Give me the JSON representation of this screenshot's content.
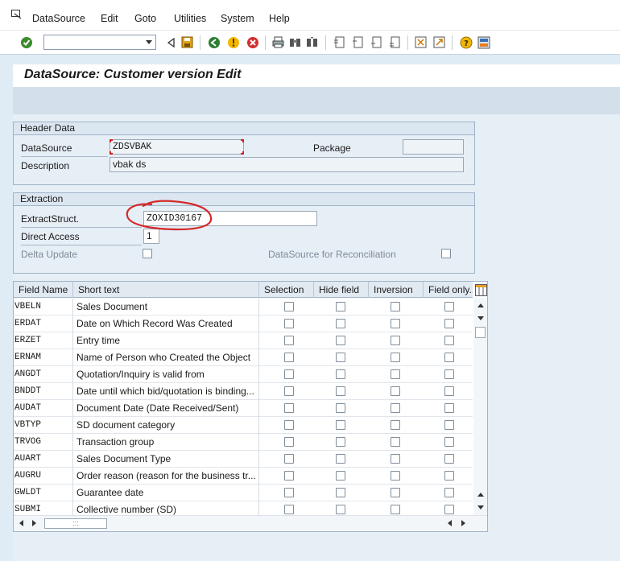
{
  "menu": [
    "DataSource",
    "Edit",
    "Goto",
    "Utilities",
    "System",
    "Help"
  ],
  "title": "DataSource: Customer version Edit",
  "header_group": {
    "title": "Header Data",
    "datasource_label": "DataSource",
    "datasource_value": "ZDSVBAK",
    "package_label": "Package",
    "package_value": "",
    "description_label": "Description",
    "description_value": "vbak ds"
  },
  "extraction_group": {
    "title": "Extraction",
    "extractstruct_label": "ExtractStruct.",
    "extractstruct_value": "ZOXID30167",
    "direct_access_label": "Direct Access",
    "direct_access_value": "1",
    "delta_update_label": "Delta Update",
    "reconciliation_label": "DataSource for Reconciliation"
  },
  "table": {
    "columns": [
      "Field Name",
      "Short text",
      "Selection",
      "Hide field",
      "Inversion",
      "Field only..."
    ],
    "rows": [
      {
        "field": "VBELN",
        "text": "Sales Document"
      },
      {
        "field": "ERDAT",
        "text": "Date on Which Record Was Created"
      },
      {
        "field": "ERZET",
        "text": "Entry time"
      },
      {
        "field": "ERNAM",
        "text": "Name of Person who Created the Object"
      },
      {
        "field": "ANGDT",
        "text": "Quotation/Inquiry is valid from"
      },
      {
        "field": "BNDDT",
        "text": "Date until which bid/quotation is binding..."
      },
      {
        "field": "AUDAT",
        "text": "Document Date (Date Received/Sent)"
      },
      {
        "field": "VBTYP",
        "text": "SD document category"
      },
      {
        "field": "TRVOG",
        "text": "Transaction group"
      },
      {
        "field": "AUART",
        "text": "Sales Document Type"
      },
      {
        "field": "AUGRU",
        "text": "Order reason (reason for the business tr..."
      },
      {
        "field": "GWLDT",
        "text": "Guarantee date"
      },
      {
        "field": "SUBMI",
        "text": "Collective number (SD)"
      }
    ],
    "hscroll_grip": ":::"
  },
  "colors": {
    "annotation": "#d42a2a",
    "background": "#dfebf5"
  }
}
